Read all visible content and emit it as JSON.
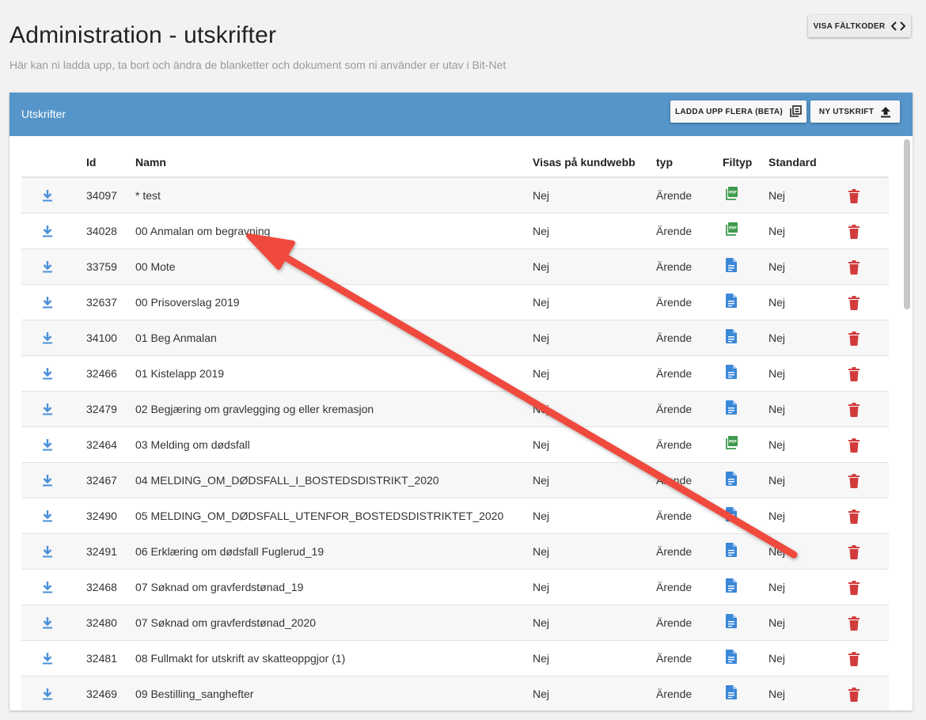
{
  "page": {
    "title": "Administration - utskrifter",
    "subtitle": "Här kan ni ladda upp, ta bort och ändra de blanketter och dokument som ni använder er utav i Bit-Net",
    "visa_button": "VISA FÄLTKODER"
  },
  "panel": {
    "title": "Utskrifter",
    "upload_many_button": "LADDA UPP FLERA (BETA)",
    "new_button": "NY UTSKRIFT"
  },
  "table": {
    "headers": {
      "id": "Id",
      "name": "Namn",
      "visas": "Visas på kundwebb",
      "typ": "typ",
      "filtyp": "Filtyp",
      "standard": "Standard"
    },
    "rows": [
      {
        "id": "34097",
        "name": "* test",
        "visas": "Nej",
        "typ": "Ärende",
        "filtyp": "pdf",
        "standard": "Nej"
      },
      {
        "id": "34028",
        "name": "00 Anmalan om begravning",
        "visas": "Nej",
        "typ": "Ärende",
        "filtyp": "pdf",
        "standard": "Nej"
      },
      {
        "id": "33759",
        "name": "00 Mote",
        "visas": "Nej",
        "typ": "Ärende",
        "filtyp": "doc",
        "standard": "Nej"
      },
      {
        "id": "32637",
        "name": "00 Prisoverslag 2019",
        "visas": "Nej",
        "typ": "Ärende",
        "filtyp": "doc",
        "standard": "Nej"
      },
      {
        "id": "34100",
        "name": "01 Beg Anmalan",
        "visas": "Nej",
        "typ": "Ärende",
        "filtyp": "doc",
        "standard": "Nej"
      },
      {
        "id": "32466",
        "name": "01 Kistelapp 2019",
        "visas": "Nej",
        "typ": "Ärende",
        "filtyp": "doc",
        "standard": "Nej"
      },
      {
        "id": "32479",
        "name": "02 Begjæring om gravlegging og eller kremasjon",
        "visas": "Nej",
        "typ": "Ärende",
        "filtyp": "doc",
        "standard": "Nej"
      },
      {
        "id": "32464",
        "name": "03 Melding om dødsfall",
        "visas": "Nej",
        "typ": "Ärende",
        "filtyp": "pdf",
        "standard": "Nej"
      },
      {
        "id": "32467",
        "name": "04 MELDING_OM_DØDSFALL_I_BOSTEDSDISTRIKT_2020",
        "visas": "Nej",
        "typ": "Ärende",
        "filtyp": "doc",
        "standard": "Nej"
      },
      {
        "id": "32490",
        "name": "05 MELDING_OM_DØDSFALL_UTENFOR_BOSTEDSDISTRIKTET_2020",
        "visas": "Nej",
        "typ": "Ärende",
        "filtyp": "doc",
        "standard": "Nej"
      },
      {
        "id": "32491",
        "name": "06 Erklæring om dødsfall Fuglerud_19",
        "visas": "Nej",
        "typ": "Ärende",
        "filtyp": "doc",
        "standard": "Nej"
      },
      {
        "id": "32468",
        "name": "07 Søknad om gravferdstønad_19",
        "visas": "Nej",
        "typ": "Ärende",
        "filtyp": "doc",
        "standard": "Nej"
      },
      {
        "id": "32480",
        "name": "07 Søknad om gravferdstønad_2020",
        "visas": "Nej",
        "typ": "Ärende",
        "filtyp": "doc",
        "standard": "Nej"
      },
      {
        "id": "32481",
        "name": "08 Fullmakt for utskrift av skatteoppgjor (1)",
        "visas": "Nej",
        "typ": "Ärende",
        "filtyp": "doc",
        "standard": "Nej"
      },
      {
        "id": "32469",
        "name": "09 Bestilling_sanghefter",
        "visas": "Nej",
        "typ": "Ärende",
        "filtyp": "doc",
        "standard": "Nej"
      }
    ]
  },
  "icons": {
    "download": "download-icon",
    "pdf": "pdf-file-icon",
    "doc": "document-icon",
    "delete": "trash-icon",
    "code": "code-icon",
    "library": "library-icon",
    "upload": "upload-icon"
  },
  "colors": {
    "header_bar": "#5595c9",
    "download_icon": "#4a90d9",
    "pdf_icon": "#3f9a4d",
    "doc_icon": "#3b87d8",
    "delete_icon": "#d23b3b",
    "annotation_arrow": "#f0483e"
  }
}
